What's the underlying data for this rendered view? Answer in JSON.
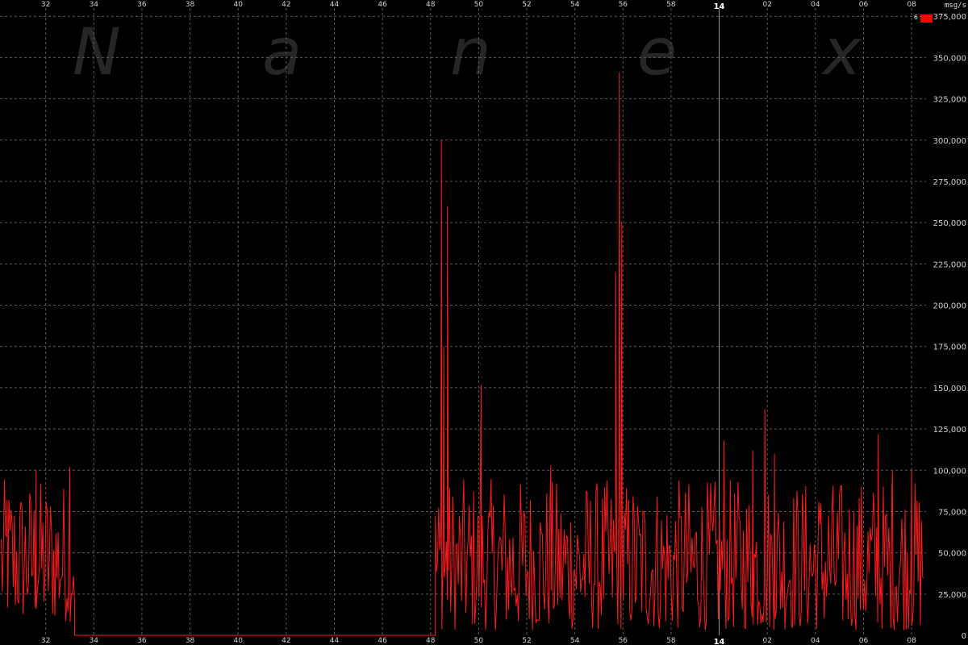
{
  "watermark": [
    "N",
    "a",
    "n",
    "e",
    "x"
  ],
  "unit_label": "msg/s",
  "legend": [
    {
      "label": "6",
      "color": "#ff0000"
    }
  ],
  "colors": {
    "background": "#000000",
    "grid": "#5a5a5a",
    "line": "#ff1a1a",
    "marker": "#9a9a9a"
  },
  "chart_data": {
    "type": "line",
    "title": "",
    "xlabel": "",
    "ylabel": "msg/s",
    "ylim": [
      0,
      380000
    ],
    "yticks": [
      0,
      25000,
      50000,
      75000,
      100000,
      125000,
      150000,
      175000,
      200000,
      225000,
      250000,
      275000,
      300000,
      325000,
      350000,
      375000
    ],
    "ytick_labels": [
      "0",
      "25,000",
      "50,000",
      "75,000",
      "100,000",
      "125,000",
      "150,000",
      "175,000",
      "200,000",
      "225,000",
      "250,000",
      "275,000",
      "300,000",
      "325,000",
      "350,000",
      "375,000"
    ],
    "x_unit": "minutes relative to the hour boundary marked 14",
    "xlim": [
      -29.9,
      8.6
    ],
    "xticks": [
      -28,
      -26,
      -24,
      -22,
      -20,
      -18,
      -16,
      -14,
      -12,
      -10,
      -8,
      -6,
      -4,
      -2,
      0,
      2,
      4,
      6,
      8
    ],
    "xtick_labels": [
      "32",
      "34",
      "36",
      "38",
      "40",
      "42",
      "44",
      "46",
      "48",
      "50",
      "52",
      "54",
      "56",
      "58",
      "14",
      "02",
      "04",
      "06",
      "08"
    ],
    "hour_marker": {
      "x": 0,
      "label": "14"
    },
    "grid": true,
    "legend_position": "top-right",
    "series": [
      {
        "name": "6",
        "color": "#ff1a1a",
        "segments": [
          {
            "x_start": -29.85,
            "x_end": -26.8,
            "level": "random",
            "min": 8000,
            "max": 95000
          },
          {
            "x_start": -26.8,
            "x_end": -11.8,
            "level": "flat",
            "value": 0
          },
          {
            "x_start": -11.8,
            "x_end": 8.5,
            "level": "random",
            "min": 3000,
            "max": 95000
          }
        ],
        "peaks": [
          {
            "x": -29.6,
            "y": 82000
          },
          {
            "x": -28.4,
            "y": 100000
          },
          {
            "x": -27.0,
            "y": 102000
          },
          {
            "x": -11.55,
            "y": 300000
          },
          {
            "x": -11.3,
            "y": 260000
          },
          {
            "x": -11.45,
            "y": 175000
          },
          {
            "x": -9.9,
            "y": 152000
          },
          {
            "x": -7.0,
            "y": 103000
          },
          {
            "x": -4.3,
            "y": 220000
          },
          {
            "x": -4.15,
            "y": 341000
          },
          {
            "x": -4.05,
            "y": 250000
          },
          {
            "x": 0.2,
            "y": 118000
          },
          {
            "x": 1.4,
            "y": 112000
          },
          {
            "x": 1.9,
            "y": 137000
          },
          {
            "x": 2.3,
            "y": 110000
          },
          {
            "x": 6.6,
            "y": 122000
          },
          {
            "x": 7.2,
            "y": 100000
          },
          {
            "x": 8.0,
            "y": 100000
          }
        ]
      }
    ]
  }
}
